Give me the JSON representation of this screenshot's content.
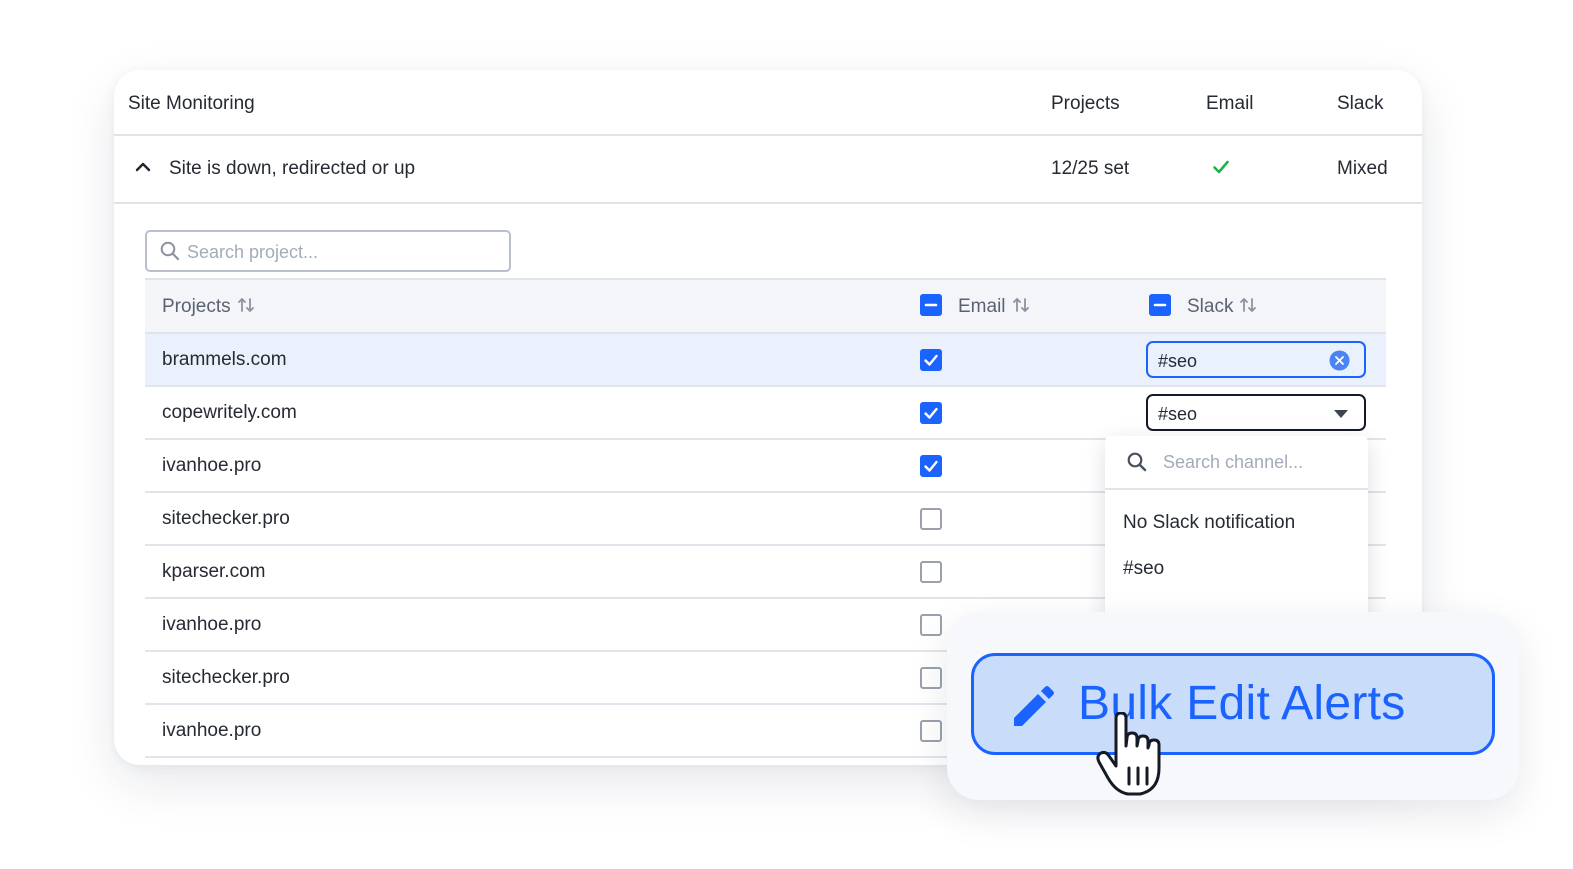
{
  "header": {
    "title": "Site Monitoring",
    "col_projects": "Projects",
    "col_email": "Email",
    "col_slack": "Slack"
  },
  "alert": {
    "title": "Site is down, redirected or up",
    "projects_count": "12/25 set",
    "email_status": "check",
    "slack_status": "Mixed"
  },
  "search": {
    "placeholder": "Search project..."
  },
  "table": {
    "col_projects": "Projects",
    "col_email": "Email",
    "col_slack": "Slack",
    "rows": [
      {
        "project": "brammels.com",
        "email": true,
        "slack": "#seo"
      },
      {
        "project": "copewritely.com",
        "email": true,
        "slack": "#seo"
      },
      {
        "project": "ivanhoe.pro",
        "email": true,
        "slack": ""
      },
      {
        "project": "sitechecker.pro",
        "email": false,
        "slack": ""
      },
      {
        "project": "kparser.com",
        "email": false,
        "slack": ""
      },
      {
        "project": "ivanhoe.pro",
        "email": false,
        "slack": ""
      },
      {
        "project": "sitechecker.pro",
        "email": false,
        "slack": ""
      },
      {
        "project": "ivanhoe.pro",
        "email": false,
        "slack": ""
      }
    ]
  },
  "dropdown": {
    "search_placeholder": "Search channel...",
    "options": [
      "No Slack notification",
      "#seo"
    ]
  },
  "bulk": {
    "label": "Bulk Edit Alerts"
  },
  "colors": {
    "accent": "#1a63ff",
    "success": "#22b24c",
    "button_bg": "#c9dcfa"
  }
}
